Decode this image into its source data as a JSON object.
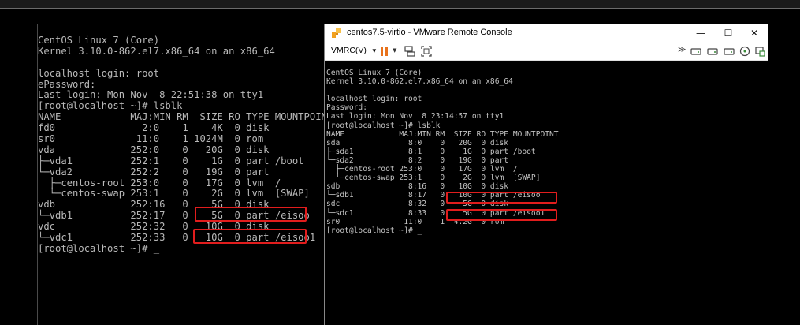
{
  "left_console": {
    "lines": [
      "CentOS Linux 7 (Core)",
      "Kernel 3.10.0-862.el7.x86_64 on an x86_64",
      "",
      "localhost login: root",
      "ePassword:",
      "Last login: Mon Nov  8 22:51:38 on tty1",
      "[root@localhost ~]# lsblk",
      "NAME            MAJ:MIN RM  SIZE RO TYPE MOUNTPOINT",
      "fd0               2:0    1    4K  0 disk",
      "sr0              11:0    1 1024M  0 rom",
      "vda             252:0    0   20G  0 disk",
      "├─vda1          252:1    0    1G  0 part /boot",
      "└─vda2          252:2    0   19G  0 part",
      "  ├─centos-root 253:0    0   17G  0 lvm  /",
      "  └─centos-swap 253:1    0    2G  0 lvm  [SWAP]",
      "vdb             252:16   0    5G  0 disk",
      "└─vdb1          252:17   0    5G  0 part /eisoo",
      "vdc             252:32   0   10G  0 disk",
      "└─vdc1          252:33   0   10G  0 part /eisoo1",
      "[root@localhost ~]# _"
    ]
  },
  "vm_window": {
    "title": "centos7.5-virtio - VMware Remote Console",
    "menu_label": "VMRC(V)",
    "minimize": "—",
    "maximize": "☐",
    "close": "✕",
    "screen_lines": [
      "CentOS Linux 7 (Core)",
      "Kernel 3.10.0-862.el7.x86_64 on an x86_64",
      "",
      "localhost login: root",
      "Password:",
      "Last login: Mon Nov  8 23:14:57 on tty1",
      "[root@localhost ~]# lsblk",
      "NAME            MAJ:MIN RM  SIZE RO TYPE MOUNTPOINT",
      "sda               8:0    0   20G  0 disk",
      "├─sda1            8:1    0    1G  0 part /boot",
      "└─sda2            8:2    0   19G  0 part",
      "  ├─centos-root 253:0    0   17G  0 lvm  /",
      "  └─centos-swap 253:1    0    2G  0 lvm  [SWAP]",
      "sdb               8:16   0   10G  0 disk",
      "└─sdb1            8:17   0   10G  0 part /eisoo",
      "sdc               8:32   0    5G  0 disk",
      "└─sdc1            8:33   0    5G  0 part /eisoo1",
      "sr0              11:0    1  4.2G  0 rom",
      "[root@localhost ~]# _"
    ]
  },
  "colors": {
    "highlight": "#e11d1d",
    "console_text": "#b8b8b8",
    "background": "#000000"
  }
}
